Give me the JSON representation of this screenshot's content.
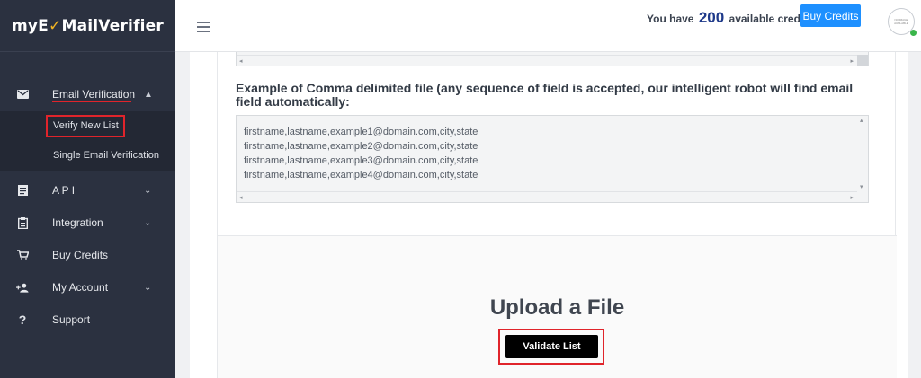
{
  "brand": {
    "prefix": "myE",
    "check": "✓",
    "suffix": "MailVerifier"
  },
  "topbar": {
    "credits_prefix": "You have",
    "credits_value": "200",
    "credits_suffix": "available credits.",
    "buy_label": "Buy Credits",
    "avatar_text": "NO IMAGE AVAILABLE"
  },
  "sidebar": {
    "items": [
      {
        "label": "Email Verification",
        "icon": "envelope-icon"
      },
      {
        "label": "A P I",
        "icon": "document-icon"
      },
      {
        "label": "Integration",
        "icon": "clipboard-icon"
      },
      {
        "label": "Buy Credits",
        "icon": "cart-icon"
      },
      {
        "label": "My Account",
        "icon": "add-user-icon"
      },
      {
        "label": "Support",
        "icon": "question-icon"
      }
    ],
    "sub_items": [
      {
        "label": "Verify New List"
      },
      {
        "label": "Single Email Verification"
      }
    ]
  },
  "main": {
    "heading": "Example of Comma delimited file (any sequence of field is accepted, our intelligent robot will find email field automatically:",
    "sample_lines": [
      "firstname,lastname,example1@domain.com,city,state",
      "firstname,lastname,example2@domain.com,city,state",
      "firstname,lastname,example3@domain.com,city,state",
      "firstname,lastname,example4@domain.com,city,state"
    ],
    "upload_title": "Upload a File",
    "validate_label": "Validate List"
  },
  "colors": {
    "sidebar_bg": "#2b3140",
    "highlight_red": "#e0242b",
    "accent_blue": "#1e90ff",
    "credits_blue": "#1f3a8a"
  }
}
